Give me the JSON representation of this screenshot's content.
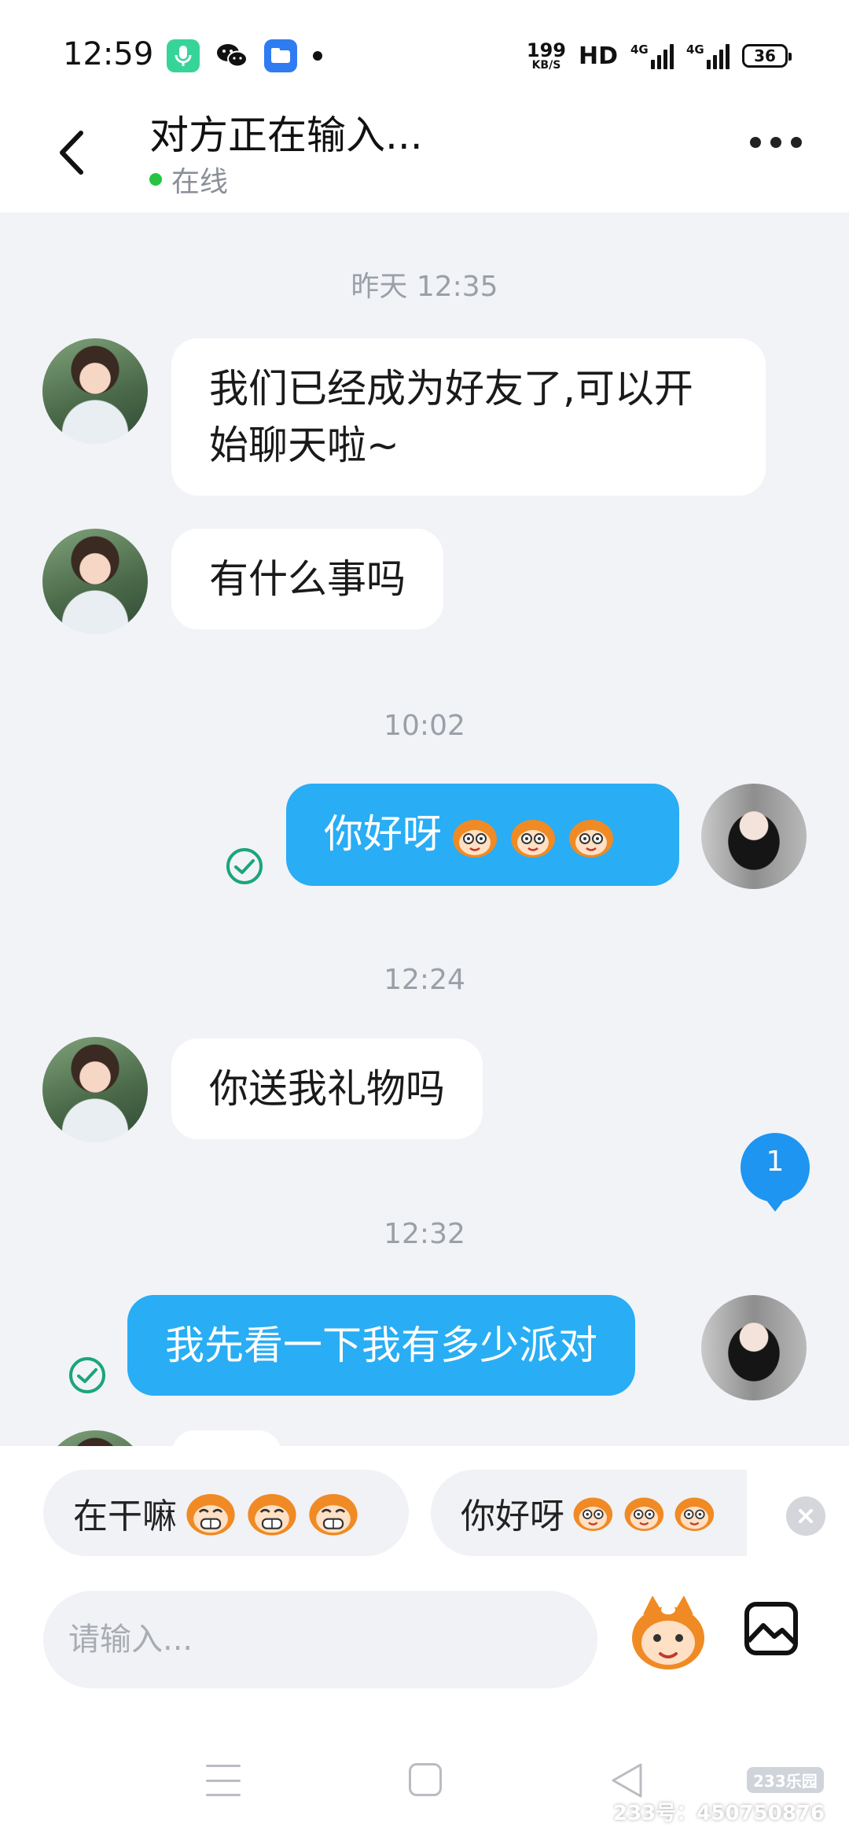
{
  "status_bar": {
    "time": "12:59",
    "net_speed_value": "199",
    "net_speed_unit": "KB/S",
    "hd_label": "HD",
    "sim1_label": "4G",
    "sim2_label": "4G",
    "battery_level": "36",
    "app_icons": [
      "microphone-icon",
      "wechat-icon",
      "files-icon"
    ]
  },
  "header": {
    "title": "对方正在输入...",
    "presence": "在线",
    "online_color": "#27c341"
  },
  "messages": [
    {
      "type": "timestamp",
      "text": "昨天 12:35"
    },
    {
      "type": "incoming",
      "text": "我们已经成为好友了,可以开始聊天啦~"
    },
    {
      "type": "incoming",
      "text": "有什么事吗"
    },
    {
      "type": "timestamp",
      "text": "10:02"
    },
    {
      "type": "outgoing",
      "text": "你好呀",
      "emoji": [
        "monkey-emoji",
        "monkey-emoji",
        "monkey-emoji"
      ],
      "status": "read"
    },
    {
      "type": "timestamp",
      "text": "12:24"
    },
    {
      "type": "incoming",
      "text": "你送我礼物吗"
    },
    {
      "type": "timestamp",
      "text": "12:32"
    },
    {
      "type": "outgoing",
      "text": "我先看一下我有多少派对",
      "status": "read"
    }
  ],
  "unread_badge": "1",
  "quick_replies": [
    {
      "text": "在干嘛",
      "emoji": [
        "grin-monkey-emoji",
        "grin-monkey-emoji",
        "grin-monkey-emoji"
      ]
    },
    {
      "text": "你好呀",
      "emoji": [
        "monkey-emoji",
        "monkey-emoji",
        "monkey-emoji"
      ]
    }
  ],
  "composer": {
    "placeholder": "请输入...",
    "value": ""
  },
  "watermark": {
    "logo": "233乐园",
    "id": "233号：450750876"
  },
  "colors": {
    "outgoing_bubble": "#29adf5",
    "incoming_bubble": "#ffffff",
    "chat_background": "#f1f3f7",
    "read_check": "#1aa57a",
    "badge": "#1e95f0"
  }
}
